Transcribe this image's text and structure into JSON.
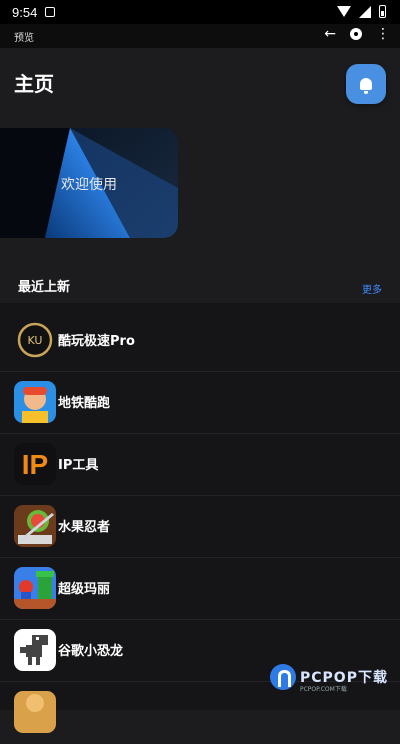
{
  "status_bar": {
    "time": "9:54"
  },
  "preview_bar": {
    "label": "预览"
  },
  "header": {
    "title": "主页"
  },
  "banner": {
    "text": "欢迎使用"
  },
  "section": {
    "title": "最近上新",
    "more": "更多"
  },
  "apps": [
    {
      "name": "酷玩极速Pro"
    },
    {
      "name": "地铁酷跑"
    },
    {
      "name": "IP工具"
    },
    {
      "name": "水果忍者"
    },
    {
      "name": "超级玛丽"
    },
    {
      "name": "谷歌小恐龙"
    }
  ],
  "watermark": {
    "text": "PCPOP下载",
    "sub": "PCPOP.COM下载"
  },
  "colors": {
    "accent": "#4a90e2",
    "link": "#3e8cff",
    "background": "#1c1c1e",
    "list_background": "#151517"
  }
}
